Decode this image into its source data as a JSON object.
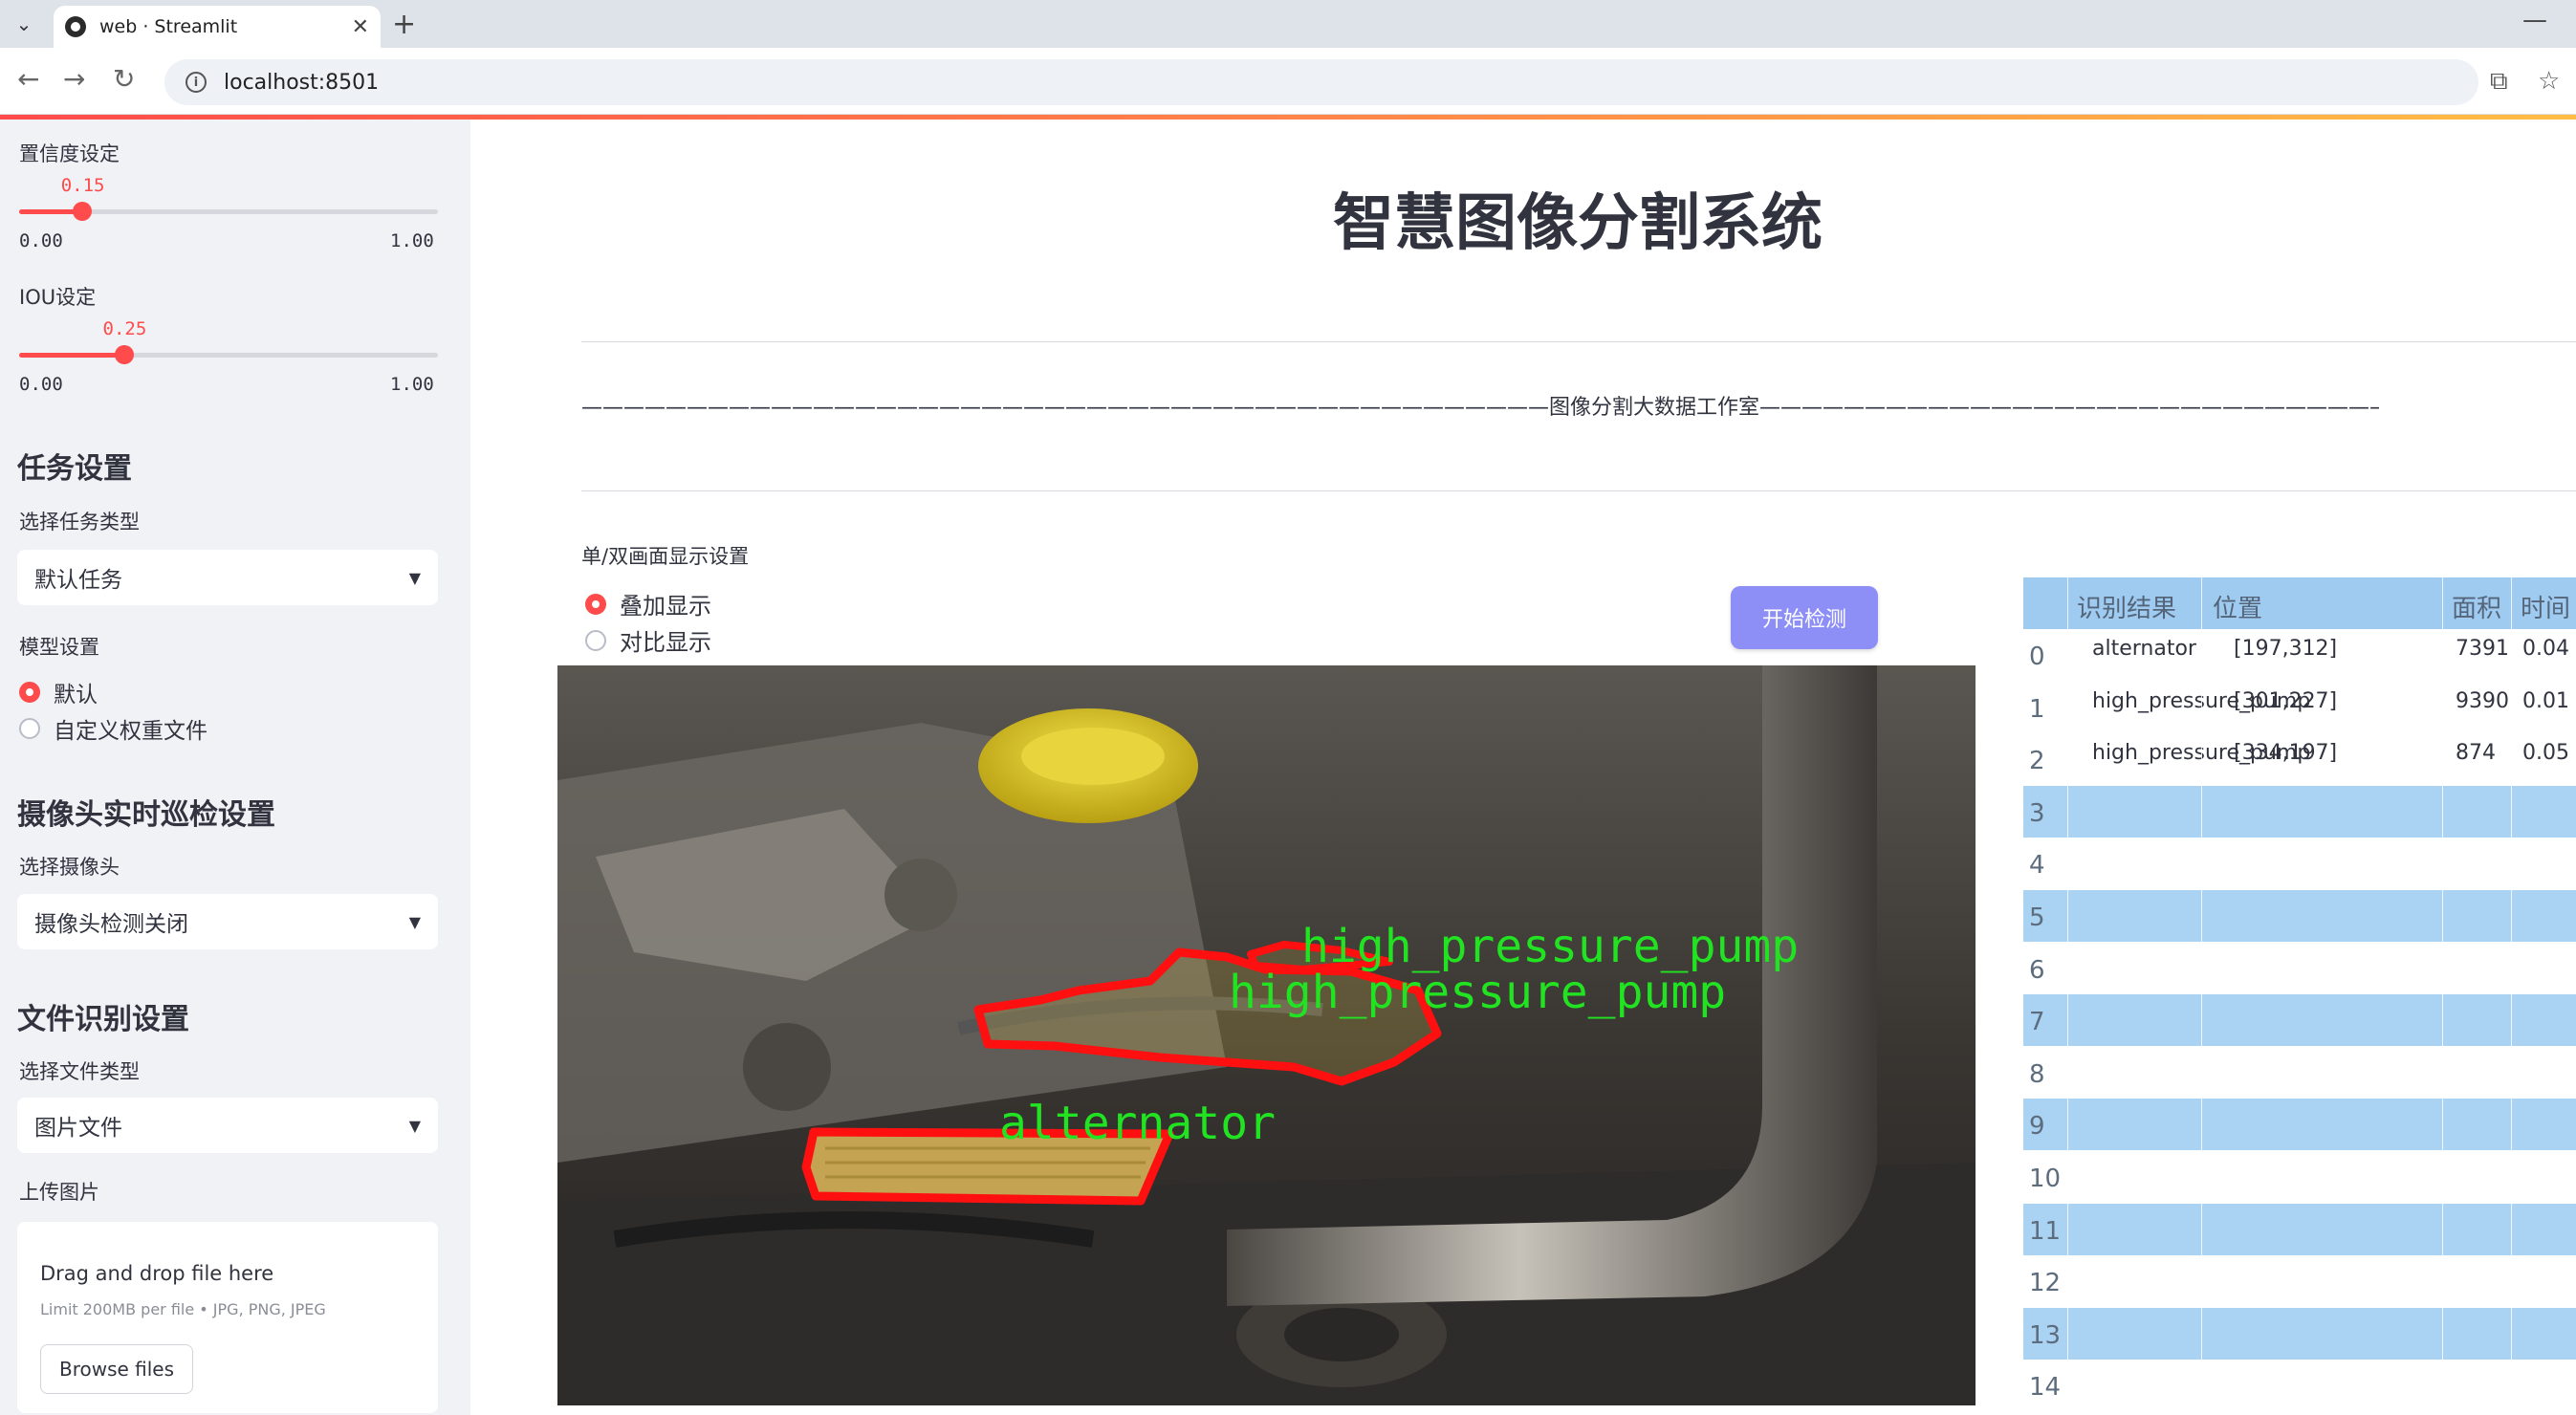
{
  "browser": {
    "tab_title": "web · Streamlit",
    "url": "localhost:8501"
  },
  "sidebar": {
    "confidence": {
      "label": "置信度设定",
      "value": "0.15",
      "fraction": 0.15,
      "min": "0.00",
      "max": "1.00"
    },
    "iou": {
      "label": "IOU设定",
      "value": "0.25",
      "fraction": 0.25,
      "min": "0.00",
      "max": "1.00"
    },
    "task": {
      "heading": "任务设置",
      "select_label": "选择任务类型",
      "selected": "默认任务"
    },
    "model": {
      "label": "模型设置",
      "options": [
        "默认",
        "自定义权重文件"
      ],
      "selected_index": 0
    },
    "camera": {
      "heading": "摄像头实时巡检设置",
      "select_label": "选择摄像头",
      "selected": "摄像头检测关闭"
    },
    "file": {
      "heading": "文件识别设置",
      "select_label": "选择文件类型",
      "selected": "图片文件"
    },
    "upload": {
      "label": "上传图片",
      "title": "Drag and drop file here",
      "limit": "Limit 200MB per file • JPG, PNG, JPEG",
      "button": "Browse files"
    }
  },
  "main": {
    "title": "智慧图像分割系统",
    "studio_line": "——————————————————————————————————————————————图像分割大数据工作室——————————————————————————————————————————————————————",
    "display_mode": {
      "label": "单/双画面显示设置",
      "options": [
        "叠加显示",
        "对比显示"
      ],
      "selected_index": 0
    },
    "start_button": "开始检测",
    "detections": [
      {
        "label": "high_pressure_pump"
      },
      {
        "label": "high_pressure_pump"
      },
      {
        "label": "alternator"
      }
    ]
  },
  "results_table": {
    "columns": [
      "识别结果",
      "位置",
      "面积",
      "时间"
    ],
    "rows": [
      {
        "index": "0",
        "result": "alternator",
        "position": "[197,312]",
        "area": "7391",
        "time": "0.04"
      },
      {
        "index": "1",
        "result": "high_pressure_pump",
        "position": "[301,227]",
        "area": "9390",
        "time": "0.01"
      },
      {
        "index": "2",
        "result": "high_pressure_pump",
        "position": "[334,197]",
        "area": "874",
        "time": "0.05"
      },
      {
        "index": "3"
      },
      {
        "index": "4"
      },
      {
        "index": "5"
      },
      {
        "index": "6"
      },
      {
        "index": "7"
      },
      {
        "index": "8"
      },
      {
        "index": "9"
      },
      {
        "index": "10"
      },
      {
        "index": "11"
      },
      {
        "index": "12"
      },
      {
        "index": "13"
      },
      {
        "index": "14"
      }
    ]
  },
  "colors": {
    "accent": "#ff4b4b",
    "button": "#8d8ff7",
    "table_header": "#9fcbf1",
    "table_stripe": "#a9d2f3",
    "seg_outline": "#ff1010",
    "seg_label": "#22e322"
  }
}
